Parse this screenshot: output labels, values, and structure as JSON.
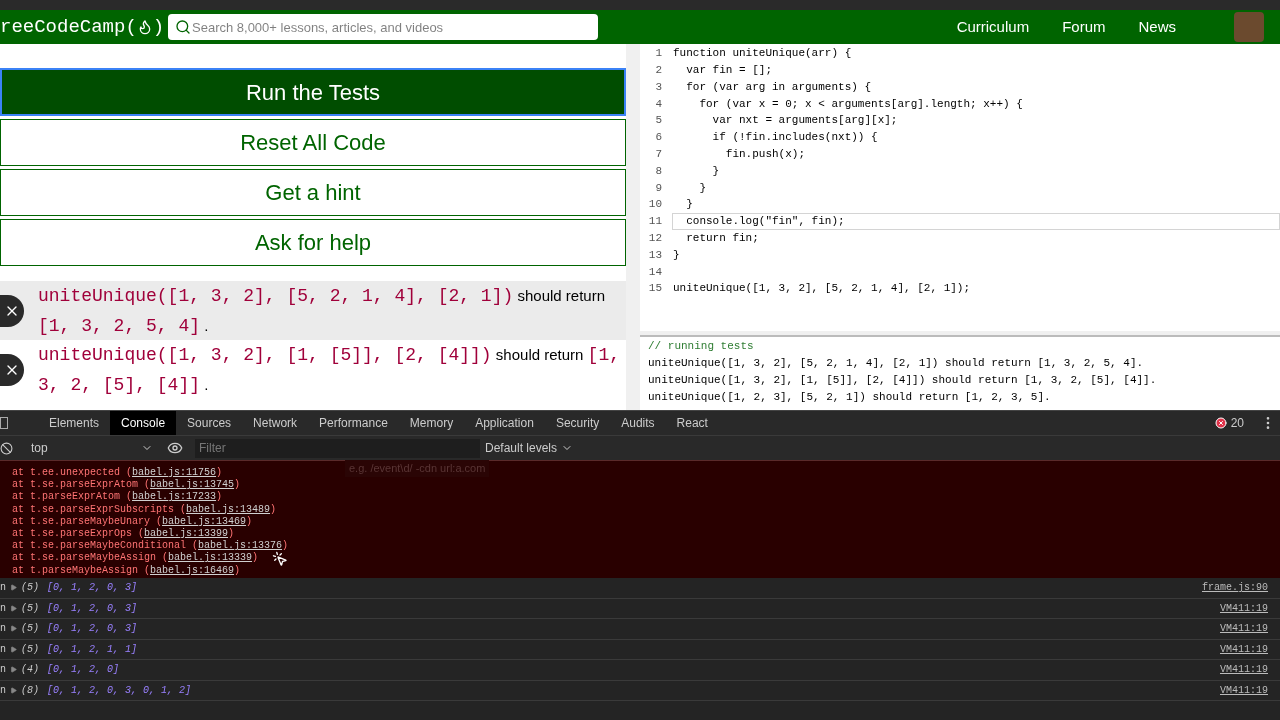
{
  "navbar": {
    "logo_text": "reeCodeCamp(",
    "logo_close": ")",
    "search": {
      "placeholder": "Search 8,000+ lessons, articles, and videos"
    },
    "links": [
      "Curriculum",
      "Forum",
      "News"
    ]
  },
  "actions": [
    {
      "label": "Run the Tests",
      "primary": true
    },
    {
      "label": "Reset All Code",
      "primary": false
    },
    {
      "label": "Get a hint",
      "primary": false
    },
    {
      "label": "Ask for help",
      "primary": false
    }
  ],
  "tests": [
    {
      "passed": false,
      "call": "uniteUnique([1, 3, 2], [5, 2, 1, 4], [2, 1])",
      "text": "should return",
      "expected": "[1, 3, 2, 5, 4]",
      "end": ".",
      "shaded": true
    },
    {
      "passed": false,
      "call": "uniteUnique([1, 3, 2], [1, [5]], [2, [4]])",
      "text": "should return",
      "expected": "[1, 3, 2, [5], [4]]",
      "end": ".",
      "shaded": false
    }
  ],
  "editor": {
    "lines": [
      {
        "number": "1",
        "code": "function uniteUnique(arr) {",
        "active": false
      },
      {
        "number": "2",
        "code": "  var fin = [];",
        "active": false
      },
      {
        "number": "3",
        "code": "  for (var arg in arguments) {",
        "active": false
      },
      {
        "number": "4",
        "code": "    for (var x = 0; x < arguments[arg].length; x++) {",
        "active": false
      },
      {
        "number": "5",
        "code": "      var nxt = arguments[arg][x];",
        "active": false
      },
      {
        "number": "6",
        "code": "      if (!fin.includes(nxt)) {",
        "active": false
      },
      {
        "number": "7",
        "code": "        fin.push(x);",
        "active": false
      },
      {
        "number": "8",
        "code": "      }",
        "active": false
      },
      {
        "number": "9",
        "code": "    }",
        "active": false
      },
      {
        "number": "10",
        "code": "  }",
        "active": false
      },
      {
        "number": "11",
        "code": "  console.log(\"fin\", fin);",
        "active": true
      },
      {
        "number": "12",
        "code": "  return fin;",
        "active": false
      },
      {
        "number": "13",
        "code": "}",
        "active": false
      },
      {
        "number": "14",
        "active": false
      },
      {
        "number": "15",
        "code": "uniteUnique([1, 3, 2], [5, 2, 1, 4], [2, 1]);",
        "active": false
      }
    ]
  },
  "output": {
    "comment": "// running tests",
    "lines": [
      "uniteUnique([1, 3, 2], [5, 2, 1, 4], [2, 1]) should return [1, 3, 2, 5, 4].",
      "uniteUnique([1, 3, 2], [1, [5]], [2, [4]]) should return [1, 3, 2, [5], [4]].",
      "uniteUnique([1, 2, 3], [5, 2, 1]) should return [1, 2, 3, 5]."
    ]
  },
  "devtools": {
    "tabs": [
      {
        "label": "Elements",
        "selected": false
      },
      {
        "label": "Console",
        "selected": true
      },
      {
        "label": "Sources",
        "selected": false
      },
      {
        "label": "Network",
        "selected": false
      },
      {
        "label": "Performance",
        "selected": false
      },
      {
        "label": "Memory",
        "selected": false
      },
      {
        "label": "Application",
        "selected": false
      },
      {
        "label": "Security",
        "selected": false
      },
      {
        "label": "Audits",
        "selected": false
      },
      {
        "label": "React",
        "selected": false
      }
    ],
    "error_count": "20",
    "context": "top",
    "filter": {
      "placeholder": "Filter",
      "hint": "e.g. /event\\d/ -cdn url:a.com"
    },
    "levels": "Default levels",
    "stack": [
      {
        "text": "at t.ee.unexpected (",
        "link": "babel.js:11756",
        "end": ")"
      },
      {
        "text": "at t.se.parseExprAtom (",
        "link": "babel.js:13745",
        "end": ")"
      },
      {
        "text": "at t.parseExprAtom (",
        "link": "babel.js:17233",
        "end": ")"
      },
      {
        "text": "at t.se.parseExprSubscripts (",
        "link": "babel.js:13489",
        "end": ")"
      },
      {
        "text": "at t.se.parseMaybeUnary (",
        "link": "babel.js:13469",
        "end": ")"
      },
      {
        "text": "at t.se.parseExprOps (",
        "link": "babel.js:13399",
        "end": ")"
      },
      {
        "text": "at t.se.parseMaybeConditional (",
        "link": "babel.js:13376",
        "end": ")"
      },
      {
        "text": "at t.se.parseMaybeAssign (",
        "link": "babel.js:13339",
        "end": ")"
      },
      {
        "text": "at t.parseMaybeAssign (",
        "link": "babel.js:16469",
        "end": ")"
      }
    ],
    "logs": [
      {
        "prefix": "n",
        "count": "(5)",
        "value": "[0, 1, 2, 0, 3]",
        "source": "frame.js:90"
      },
      {
        "prefix": "n",
        "count": "(5)",
        "value": "[0, 1, 2, 0, 3]",
        "source": "VM411:19"
      },
      {
        "prefix": "n",
        "count": "(5)",
        "value": "[0, 1, 2, 0, 3]",
        "source": "VM411:19"
      },
      {
        "prefix": "n",
        "count": "(5)",
        "value": "[0, 1, 2, 1, 1]",
        "source": "VM411:19"
      },
      {
        "prefix": "n",
        "count": "(4)",
        "value": "[0, 1, 2, 0]",
        "source": "VM411:19"
      },
      {
        "prefix": "n",
        "count": "(8)",
        "value": "[0, 1, 2, 0, 3, 0, 1, 2]",
        "source": "VM411:19"
      }
    ]
  }
}
